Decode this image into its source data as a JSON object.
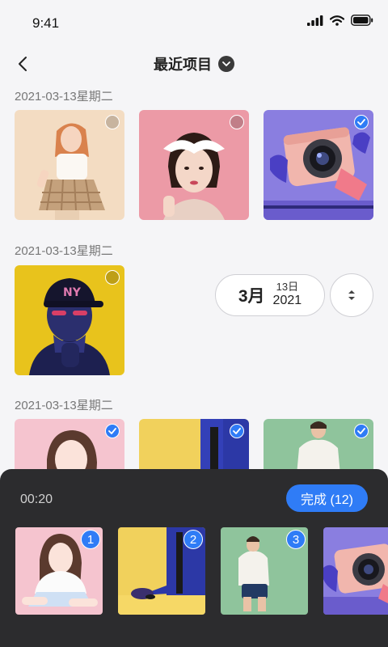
{
  "status_bar": {
    "time": "9:41"
  },
  "nav": {
    "title": "最近项目"
  },
  "sections": [
    {
      "date": "2021-03-13星期二"
    },
    {
      "date": "2021-03-13星期二"
    },
    {
      "date": "2021-03-13星期二"
    }
  ],
  "date_pill": {
    "month": "3月",
    "day": "13日",
    "year": "2021"
  },
  "bottom": {
    "duration": "00:20",
    "done_label": "完成 (12)",
    "indexes": [
      "1",
      "2",
      "3"
    ]
  },
  "colors": {
    "accent": "#2f7cf6",
    "panel": "#2c2c2e",
    "background": "#f5f5f7"
  },
  "icons": [
    "back-icon",
    "chevron-down-icon",
    "signal-icon",
    "wifi-icon",
    "battery-icon",
    "check-icon",
    "sort-icon"
  ]
}
